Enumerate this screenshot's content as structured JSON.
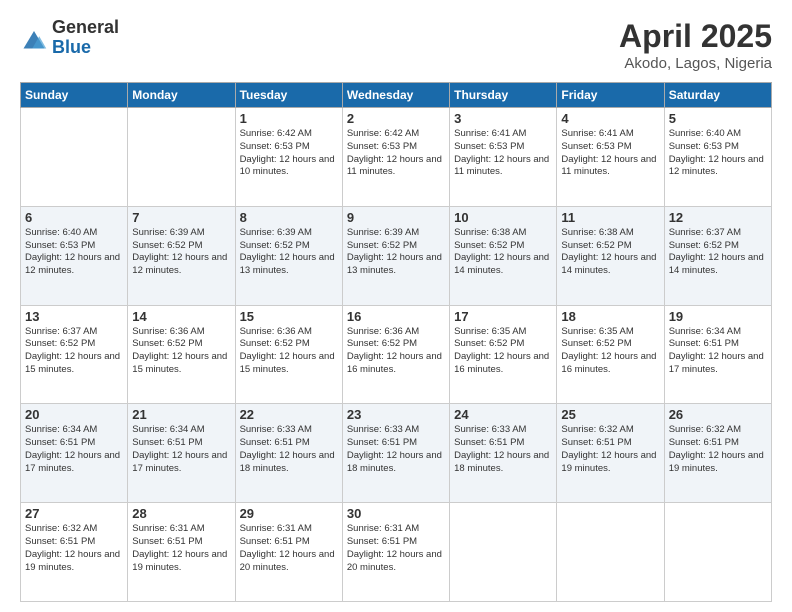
{
  "logo": {
    "general": "General",
    "blue": "Blue"
  },
  "title": "April 2025",
  "subtitle": "Akodo, Lagos, Nigeria",
  "days_of_week": [
    "Sunday",
    "Monday",
    "Tuesday",
    "Wednesday",
    "Thursday",
    "Friday",
    "Saturday"
  ],
  "weeks": [
    [
      {
        "day": "",
        "info": ""
      },
      {
        "day": "",
        "info": ""
      },
      {
        "day": "1",
        "info": "Sunrise: 6:42 AM\nSunset: 6:53 PM\nDaylight: 12 hours and 10 minutes."
      },
      {
        "day": "2",
        "info": "Sunrise: 6:42 AM\nSunset: 6:53 PM\nDaylight: 12 hours and 11 minutes."
      },
      {
        "day": "3",
        "info": "Sunrise: 6:41 AM\nSunset: 6:53 PM\nDaylight: 12 hours and 11 minutes."
      },
      {
        "day": "4",
        "info": "Sunrise: 6:41 AM\nSunset: 6:53 PM\nDaylight: 12 hours and 11 minutes."
      },
      {
        "day": "5",
        "info": "Sunrise: 6:40 AM\nSunset: 6:53 PM\nDaylight: 12 hours and 12 minutes."
      }
    ],
    [
      {
        "day": "6",
        "info": "Sunrise: 6:40 AM\nSunset: 6:53 PM\nDaylight: 12 hours and 12 minutes."
      },
      {
        "day": "7",
        "info": "Sunrise: 6:39 AM\nSunset: 6:52 PM\nDaylight: 12 hours and 12 minutes."
      },
      {
        "day": "8",
        "info": "Sunrise: 6:39 AM\nSunset: 6:52 PM\nDaylight: 12 hours and 13 minutes."
      },
      {
        "day": "9",
        "info": "Sunrise: 6:39 AM\nSunset: 6:52 PM\nDaylight: 12 hours and 13 minutes."
      },
      {
        "day": "10",
        "info": "Sunrise: 6:38 AM\nSunset: 6:52 PM\nDaylight: 12 hours and 14 minutes."
      },
      {
        "day": "11",
        "info": "Sunrise: 6:38 AM\nSunset: 6:52 PM\nDaylight: 12 hours and 14 minutes."
      },
      {
        "day": "12",
        "info": "Sunrise: 6:37 AM\nSunset: 6:52 PM\nDaylight: 12 hours and 14 minutes."
      }
    ],
    [
      {
        "day": "13",
        "info": "Sunrise: 6:37 AM\nSunset: 6:52 PM\nDaylight: 12 hours and 15 minutes."
      },
      {
        "day": "14",
        "info": "Sunrise: 6:36 AM\nSunset: 6:52 PM\nDaylight: 12 hours and 15 minutes."
      },
      {
        "day": "15",
        "info": "Sunrise: 6:36 AM\nSunset: 6:52 PM\nDaylight: 12 hours and 15 minutes."
      },
      {
        "day": "16",
        "info": "Sunrise: 6:36 AM\nSunset: 6:52 PM\nDaylight: 12 hours and 16 minutes."
      },
      {
        "day": "17",
        "info": "Sunrise: 6:35 AM\nSunset: 6:52 PM\nDaylight: 12 hours and 16 minutes."
      },
      {
        "day": "18",
        "info": "Sunrise: 6:35 AM\nSunset: 6:52 PM\nDaylight: 12 hours and 16 minutes."
      },
      {
        "day": "19",
        "info": "Sunrise: 6:34 AM\nSunset: 6:51 PM\nDaylight: 12 hours and 17 minutes."
      }
    ],
    [
      {
        "day": "20",
        "info": "Sunrise: 6:34 AM\nSunset: 6:51 PM\nDaylight: 12 hours and 17 minutes."
      },
      {
        "day": "21",
        "info": "Sunrise: 6:34 AM\nSunset: 6:51 PM\nDaylight: 12 hours and 17 minutes."
      },
      {
        "day": "22",
        "info": "Sunrise: 6:33 AM\nSunset: 6:51 PM\nDaylight: 12 hours and 18 minutes."
      },
      {
        "day": "23",
        "info": "Sunrise: 6:33 AM\nSunset: 6:51 PM\nDaylight: 12 hours and 18 minutes."
      },
      {
        "day": "24",
        "info": "Sunrise: 6:33 AM\nSunset: 6:51 PM\nDaylight: 12 hours and 18 minutes."
      },
      {
        "day": "25",
        "info": "Sunrise: 6:32 AM\nSunset: 6:51 PM\nDaylight: 12 hours and 19 minutes."
      },
      {
        "day": "26",
        "info": "Sunrise: 6:32 AM\nSunset: 6:51 PM\nDaylight: 12 hours and 19 minutes."
      }
    ],
    [
      {
        "day": "27",
        "info": "Sunrise: 6:32 AM\nSunset: 6:51 PM\nDaylight: 12 hours and 19 minutes."
      },
      {
        "day": "28",
        "info": "Sunrise: 6:31 AM\nSunset: 6:51 PM\nDaylight: 12 hours and 19 minutes."
      },
      {
        "day": "29",
        "info": "Sunrise: 6:31 AM\nSunset: 6:51 PM\nDaylight: 12 hours and 20 minutes."
      },
      {
        "day": "30",
        "info": "Sunrise: 6:31 AM\nSunset: 6:51 PM\nDaylight: 12 hours and 20 minutes."
      },
      {
        "day": "",
        "info": ""
      },
      {
        "day": "",
        "info": ""
      },
      {
        "day": "",
        "info": ""
      }
    ]
  ]
}
